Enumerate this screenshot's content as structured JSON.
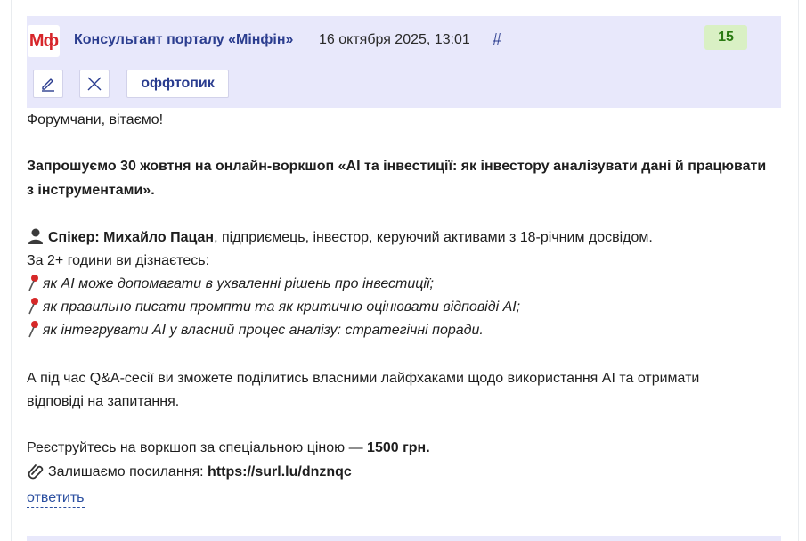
{
  "post": {
    "logo_text": "Мф",
    "author": "Консультант порталу «Мінфін»",
    "datetime": "16 октября 2025, 13:01",
    "hash": "#",
    "count": "15",
    "tag_label": "оффтопик",
    "icons": [
      "pencil-icon",
      "close-icon"
    ],
    "colors": {
      "header_bg": "#e8e8fb",
      "author": "#2b3d8f",
      "badge_bg": "#d9f0c4",
      "badge_text": "#2a7a12",
      "logo": "#d7262a"
    }
  },
  "content": {
    "greeting": "Форумчани, вітаємо!",
    "invite_line1": "Запрошуємо 30 жовтня на онлайн-воркшоп «AI та інвестиції: як інвестору аналізувати дані й працювати",
    "invite_line2": "з інструментами».",
    "speaker_label": "Спікер: Михайло Пацан",
    "speaker_rest": ", підприємець, інвестор, керуючий активами з 18-річним досвідом.",
    "learn_intro": "За 2+ години ви дізнаєтесь:",
    "points": [
      "як AI може допомагати в ухваленні рішень про інвестиції;",
      "як правильно писати промпти та як критично оцінювати відповіді AI;",
      "як інтегрувати AI у власний процес аналізу: стратегічні поради."
    ],
    "qa_line1": "А під час Q&A-сесії ви зможете поділитись власними лайфхаками щодо використання AI та отримати",
    "qa_line2": "відповіді на запитання.",
    "register_text": "Реєструйтесь на воркшоп за спеціальною ціною — ",
    "register_price": "1500 грн.",
    "link_label": "Залишаємо посилання: ",
    "link_url": "https://surl.lu/dnznqc"
  },
  "actions": {
    "reply": "ответить"
  }
}
